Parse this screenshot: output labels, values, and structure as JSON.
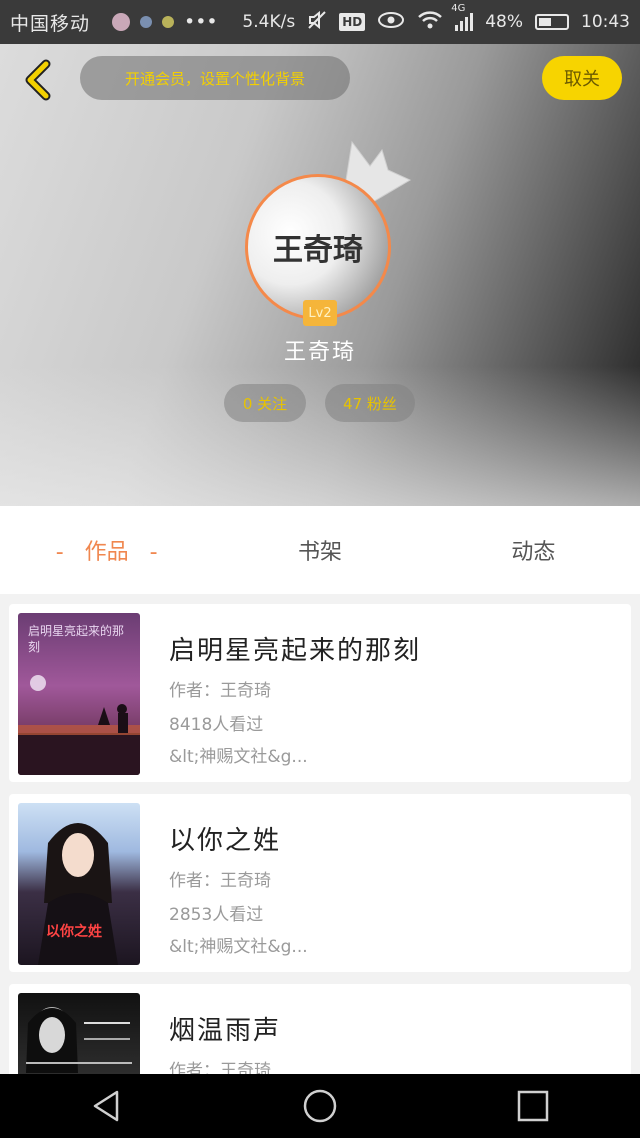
{
  "status_bar": {
    "carrier": "中国移动",
    "speed": "5.4K/s",
    "hd": "HD",
    "network": "4G",
    "battery_label": "48%",
    "battery_level": 0.48,
    "time": "10:43"
  },
  "header": {
    "vip_banner": "开通会员，设置个性化背景",
    "unfollow": "取关",
    "avatar_text": "王奇琦",
    "level": "Lv2",
    "username": "王奇琦",
    "follow_count": "0 关注",
    "fans_count": "47 粉丝"
  },
  "tabs": [
    {
      "label": "作品"
    },
    {
      "label": "书架"
    },
    {
      "label": "动态"
    }
  ],
  "books": [
    {
      "title": "启明星亮起来的那刻",
      "author": "作者：王奇琦",
      "views": "8418人看过",
      "publisher": "&lt;神赐文社&g...",
      "cover_text": "启明星亮起来的那刻"
    },
    {
      "title": "以你之姓",
      "author": "作者：王奇琦",
      "views": "2853人看过",
      "publisher": "&lt;神赐文社&g...",
      "cover_text": "以你之姓"
    },
    {
      "title": "烟温雨声",
      "author": "作者：王奇琦",
      "views": "",
      "publisher": "",
      "cover_text": ""
    }
  ],
  "colors": {
    "accent_orange": "#f0874f",
    "accent_yellow": "#f7d400"
  }
}
